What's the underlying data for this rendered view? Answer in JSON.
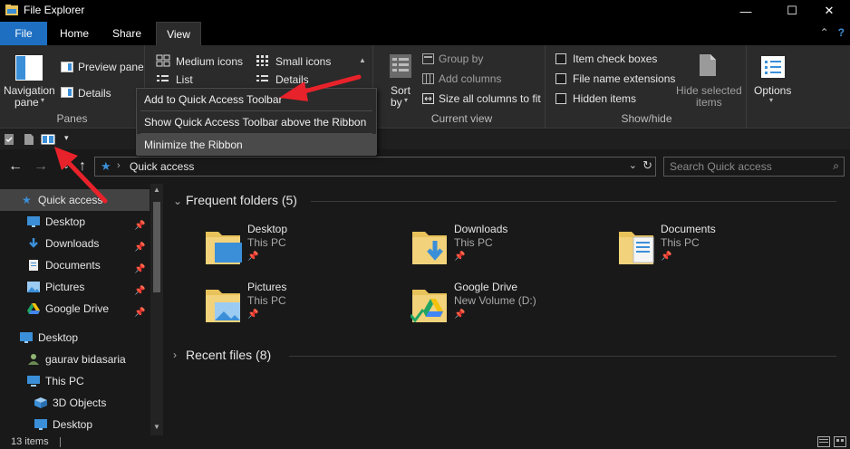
{
  "window": {
    "title": "File Explorer",
    "controls": [
      "—",
      "☐",
      "✕"
    ]
  },
  "tabs": [
    {
      "label": "File"
    },
    {
      "label": "Home"
    },
    {
      "label": "Share"
    },
    {
      "label": "View"
    }
  ],
  "ribbon": {
    "panes": {
      "navigation_pane": "Navigation",
      "navigation_pane2": "pane",
      "preview_pane": "Preview pane",
      "details_pane": "Details",
      "label": "Panes"
    },
    "layout": {
      "medium_icons": "Medium icons",
      "small_icons": "Small icons",
      "list": "List",
      "details": "Details"
    },
    "current_view": {
      "sort_by": "Sort",
      "sort_by2": "by",
      "group_by": "Group by",
      "add_columns": "Add columns",
      "size_all_columns": "Size all columns to fit",
      "label": "Current view"
    },
    "show_hide": {
      "item_check_boxes": "Item check boxes",
      "file_name_extensions": "File name extensions",
      "hidden_items": "Hidden items",
      "hide_selected": "Hide selected",
      "hide_selected2": "items",
      "label": "Show/hide"
    },
    "options": "Options"
  },
  "context_menu": {
    "items": [
      {
        "label": "Add to Quick Access Toolbar"
      },
      {
        "label": "Show Quick Access Toolbar above the Ribbon"
      },
      {
        "label": "Minimize the Ribbon"
      }
    ]
  },
  "address": {
    "path": "Quick access",
    "search_placeholder": "Search Quick access"
  },
  "nav": {
    "items": [
      {
        "label": "Quick access",
        "icon": "star-icon"
      },
      {
        "label": "Desktop",
        "icon": "desktop-icon"
      },
      {
        "label": "Downloads",
        "icon": "download-icon"
      },
      {
        "label": "Documents",
        "icon": "documents-icon"
      },
      {
        "label": "Pictures",
        "icon": "pictures-icon"
      },
      {
        "label": "Google Drive",
        "icon": "google-drive-icon"
      },
      {
        "label": "Desktop",
        "icon": "desktop-icon"
      },
      {
        "label": "gaurav bidasaria",
        "icon": "user-icon"
      },
      {
        "label": "This PC",
        "icon": "pc-icon"
      },
      {
        "label": "3D Objects",
        "icon": "cube-icon"
      },
      {
        "label": "Desktop",
        "icon": "desktop-icon"
      }
    ]
  },
  "content": {
    "frequent_header": "Frequent folders (5)",
    "recent_header": "Recent files (8)",
    "folders": [
      {
        "name": "Desktop",
        "location": "This PC"
      },
      {
        "name": "Downloads",
        "location": "This PC"
      },
      {
        "name": "Documents",
        "location": "This PC"
      },
      {
        "name": "Pictures",
        "location": "This PC"
      },
      {
        "name": "Google Drive",
        "location": "New Volume (D:)"
      }
    ]
  },
  "status": {
    "items_count": "13 items"
  },
  "colors": {
    "file_tab": "#1e6fc2",
    "arrow": "#e8222a",
    "folder_yellow": "#e8c25a"
  }
}
